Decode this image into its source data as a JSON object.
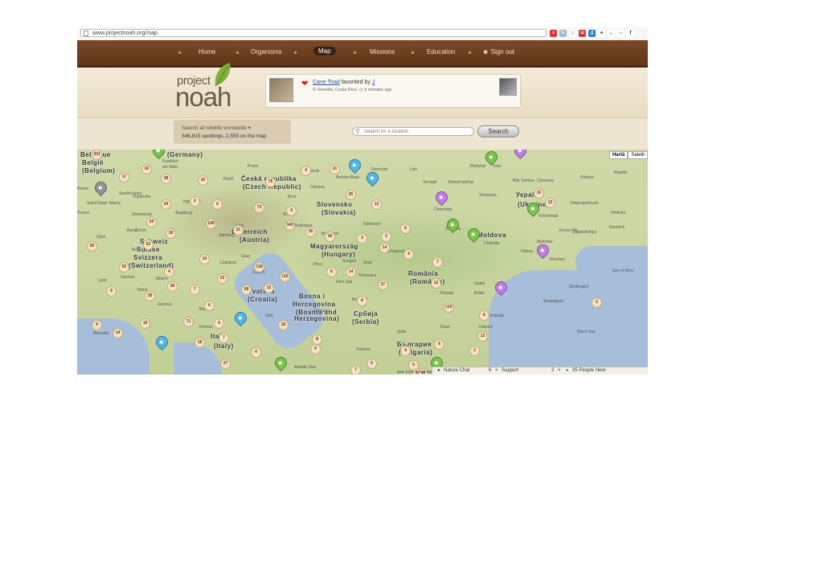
{
  "browser": {
    "url": "www.projectnoah.org/map"
  },
  "nav": {
    "items": [
      "Home",
      "Organisms",
      "Map",
      "Missions",
      "Education",
      "Sign out"
    ],
    "active": "Map"
  },
  "logo": {
    "top": "project",
    "main": "noah"
  },
  "feed": {
    "subject": "Cane Toad",
    "action": "favorited by",
    "user": "J",
    "location": "Heredia, Costa Rica",
    "time": "9 minutes ago"
  },
  "stats": {
    "title": "Search all wildlife worldwide ▾",
    "count": "346,815 spottings, 2,555 on the map"
  },
  "search": {
    "placeholder": "Search for a location",
    "button": "Search"
  },
  "map": {
    "type_buttons": [
      "Hartă",
      "Satelit"
    ],
    "countries": [
      [
        "(Germany)",
        112,
        2
      ],
      [
        "Belgique",
        4,
        2
      ],
      [
        "België",
        6,
        12
      ],
      [
        "(Belgium)",
        6,
        22
      ],
      [
        "Česká republika",
        204,
        32
      ],
      [
        "(Czech Republic)",
        206,
        42
      ],
      [
        "Slovensko",
        298,
        64
      ],
      [
        "(Slovakia)",
        304,
        74
      ],
      [
        "Österreich",
        192,
        98
      ],
      [
        "(Austria)",
        202,
        108
      ],
      [
        "Magyarország",
        290,
        116
      ],
      [
        "(Hungary)",
        304,
        126
      ],
      [
        "Schweiz",
        78,
        110
      ],
      [
        "Suisse",
        74,
        120
      ],
      [
        "Svizzera",
        70,
        130
      ],
      [
        "(Switzerland)",
        64,
        140
      ],
      [
        "România",
        412,
        150
      ],
      [
        "(România)",
        414,
        160
      ],
      [
        "Україна",
        546,
        52
      ],
      [
        "(Ukraine)",
        548,
        64
      ],
      [
        "Moldova",
        498,
        102
      ],
      [
        "Hrvatska",
        208,
        172
      ],
      [
        "(Croatia)",
        212,
        182
      ],
      [
        "Bosna i",
        276,
        178
      ],
      [
        "Hercegovina",
        268,
        188
      ],
      [
        "(Bosnia and",
        272,
        198
      ],
      [
        "Herzegovina)",
        270,
        206
      ],
      [
        "Србија",
        344,
        200
      ],
      [
        "(Serbia)",
        342,
        210
      ],
      [
        "Italia",
        166,
        228
      ],
      [
        "(Italy)",
        170,
        240
      ],
      [
        "България",
        398,
        238
      ],
      [
        "(Bulgaria)",
        400,
        248
      ]
    ],
    "cities": [
      [
        "Frankfurt",
        106,
        12
      ],
      [
        "am Main",
        106,
        19
      ],
      [
        "Praha",
        212,
        18
      ],
      [
        "Rybnik",
        286,
        24
      ],
      [
        "Bielsko-Biała",
        322,
        32
      ],
      [
        "Rzeszów",
        366,
        22
      ],
      [
        "Lviv",
        414,
        22
      ],
      [
        "Ternopil",
        430,
        38
      ],
      [
        "Khmel'nyts'kyi",
        462,
        38
      ],
      [
        "Zhytomyr",
        488,
        18
      ],
      [
        "Kiev",
        518,
        18
      ],
      [
        "Poltava",
        626,
        32
      ],
      [
        "Cherkasy",
        572,
        36
      ],
      [
        "Bila Tserkva",
        542,
        36
      ],
      [
        "Vinnytsya",
        500,
        54
      ],
      [
        "Kirovohrad",
        574,
        80
      ],
      [
        "Dnipropetrovs'k",
        614,
        64
      ],
      [
        "Zaporizhzhya",
        616,
        100
      ],
      [
        "Kryvyi Rih",
        600,
        98
      ],
      [
        "Mykolaiv",
        572,
        112
      ],
      [
        "Odesa",
        552,
        124
      ],
      [
        "Kherson",
        588,
        134
      ],
      [
        "Chişinău",
        506,
        114
      ],
      [
        "Chernivtsi",
        444,
        72
      ],
      [
        "Suceava",
        458,
        96
      ],
      [
        "Galati",
        494,
        164
      ],
      [
        "Brăila",
        494,
        176
      ],
      [
        "Ploieşti",
        452,
        176
      ],
      [
        "Constanţa",
        508,
        204
      ],
      [
        "Dobrich",
        500,
        218
      ],
      [
        "Varna",
        498,
        232
      ],
      [
        "Ruse",
        452,
        218
      ],
      [
        "Sofia",
        398,
        224
      ],
      [
        "Kosovo",
        348,
        246
      ],
      [
        "Wien",
        256,
        78
      ],
      [
        "Bratislava",
        270,
        92
      ],
      [
        "Budapest",
        304,
        102
      ],
      [
        "Debrecen",
        356,
        90
      ],
      [
        "Szeged",
        330,
        136
      ],
      [
        "Timişoara",
        350,
        154
      ],
      [
        "Arad",
        356,
        138
      ],
      [
        "Cluj-Napoca",
        380,
        124
      ],
      [
        "Novi Sad",
        322,
        162
      ],
      [
        "Beograd",
        342,
        184
      ],
      [
        "Zürich",
        72,
        98
      ],
      [
        "Basel",
        62,
        98
      ],
      [
        "Bern",
        68,
        122
      ],
      [
        "Genève",
        54,
        156
      ],
      [
        "Lyon",
        26,
        160
      ],
      [
        "Marseille",
        20,
        226
      ],
      [
        "Milano",
        98,
        158
      ],
      [
        "Torino",
        74,
        172
      ],
      [
        "Genova",
        100,
        190
      ],
      [
        "Bologna",
        152,
        196
      ],
      [
        "Firenze",
        152,
        218
      ],
      [
        "Ljubljana",
        178,
        138
      ],
      [
        "Zagreb",
        218,
        150
      ],
      [
        "Graz",
        204,
        130
      ],
      [
        "Linz",
        198,
        92
      ],
      [
        "Salzburg",
        176,
        104
      ],
      [
        "Nancy",
        40,
        64
      ],
      [
        "Saarbrücken",
        52,
        52
      ],
      [
        "Strasbourg",
        68,
        78
      ],
      [
        "Karlsruhe",
        70,
        56
      ],
      [
        "Augsburg",
        122,
        76
      ],
      [
        "Ingolstadt",
        132,
        62
      ],
      [
        "Plzeň",
        182,
        34
      ],
      [
        "Brno",
        262,
        56
      ],
      [
        "Ostrava",
        290,
        44
      ],
      [
        "Pécs",
        294,
        140
      ],
      [
        "Split",
        234,
        204
      ],
      [
        "Sarajevo",
        294,
        198
      ],
      [
        "Simferopol",
        612,
        168
      ],
      [
        "Sevastopol",
        580,
        186
      ],
      [
        "Black Sea",
        622,
        224
      ],
      [
        "Sea of Azov",
        666,
        148
      ],
      [
        "Adriatic Sea",
        270,
        268
      ],
      [
        "Reims",
        0,
        46
      ],
      [
        "Troyes",
        0,
        76
      ],
      [
        "Dijon",
        24,
        106
      ],
      [
        "Saint-Dizier",
        12,
        64
      ],
      [
        "Kharkiv",
        668,
        26
      ],
      [
        "Horlivka",
        664,
        76
      ],
      [
        "Donets'k",
        662,
        94
      ]
    ],
    "clusters": [
      [
        "201",
        18,
        0
      ],
      [
        "33",
        80,
        18
      ],
      [
        "38",
        104,
        30
      ],
      [
        "17",
        52,
        28
      ],
      [
        "16",
        150,
        32
      ],
      [
        "76",
        234,
        34
      ],
      [
        "4",
        278,
        20
      ],
      [
        "21",
        314,
        18
      ],
      [
        "25",
        334,
        50
      ],
      [
        "12",
        366,
        62
      ],
      [
        "6",
        402,
        92
      ],
      [
        "15",
        568,
        48
      ],
      [
        "13",
        582,
        60
      ],
      [
        "2",
        140,
        58
      ],
      [
        "24",
        104,
        62
      ],
      [
        "6",
        168,
        62
      ],
      [
        "73",
        220,
        66
      ],
      [
        "4",
        260,
        70
      ],
      [
        "20",
        86,
        84
      ],
      [
        "106",
        160,
        86
      ],
      [
        "21",
        194,
        94
      ],
      [
        "345",
        258,
        88
      ],
      [
        "35",
        284,
        96
      ],
      [
        "36",
        308,
        102
      ],
      [
        "3",
        348,
        104
      ],
      [
        "3",
        378,
        102
      ],
      [
        "14",
        376,
        116
      ],
      [
        "4",
        406,
        124
      ],
      [
        "28",
        110,
        98
      ],
      [
        "53",
        82,
        112
      ],
      [
        "20",
        12,
        114
      ],
      [
        "14",
        152,
        130
      ],
      [
        "7",
        442,
        134
      ],
      [
        "118",
        220,
        140
      ],
      [
        "116",
        252,
        152
      ],
      [
        "6",
        310,
        146
      ],
      [
        "14",
        334,
        146
      ],
      [
        "92",
        52,
        140
      ],
      [
        "4",
        108,
        146
      ],
      [
        "23",
        174,
        154
      ],
      [
        "36",
        112,
        164
      ],
      [
        "7",
        140,
        168
      ],
      [
        "68",
        204,
        168
      ],
      [
        "12",
        232,
        166
      ],
      [
        "27",
        374,
        162
      ],
      [
        "12",
        440,
        160
      ],
      [
        "9",
        36,
        170
      ],
      [
        "28",
        84,
        176
      ],
      [
        "6",
        158,
        188
      ],
      [
        "8",
        348,
        182
      ],
      [
        "116",
        456,
        190
      ],
      [
        "6",
        500,
        200
      ],
      [
        "71",
        132,
        208
      ],
      [
        "4",
        170,
        210
      ],
      [
        "18",
        78,
        210
      ],
      [
        "9",
        18,
        212
      ],
      [
        "14",
        44,
        222
      ],
      [
        "16",
        250,
        212
      ],
      [
        "13",
        498,
        226
      ],
      [
        "2",
        640,
        184
      ],
      [
        "18",
        146,
        234
      ],
      [
        "7",
        176,
        228
      ],
      [
        "4",
        216,
        246
      ],
      [
        "8",
        292,
        230
      ],
      [
        "9",
        290,
        242
      ],
      [
        "4",
        402,
        244
      ],
      [
        "6",
        444,
        236
      ],
      [
        "2",
        488,
        244
      ],
      [
        "27",
        178,
        260
      ],
      [
        "5",
        360,
        260
      ],
      [
        "6",
        412,
        262
      ],
      [
        "5",
        416,
        272
      ],
      [
        "7",
        340,
        268
      ],
      [
        "12",
        502,
        268
      ],
      [
        "10",
        424,
        272
      ]
    ],
    "pins": [
      [
        "green",
        94,
        -6
      ],
      [
        "green",
        508,
        2
      ],
      [
        "purple",
        544,
        -6
      ],
      [
        "gray",
        22,
        40
      ],
      [
        "blue",
        338,
        12
      ],
      [
        "blue",
        360,
        28
      ],
      [
        "purple",
        446,
        52
      ],
      [
        "green",
        460,
        86
      ],
      [
        "green",
        486,
        98
      ],
      [
        "green",
        560,
        66
      ],
      [
        "purple",
        572,
        118
      ],
      [
        "purple",
        520,
        164
      ],
      [
        "blue",
        196,
        202
      ],
      [
        "blue",
        98,
        232
      ],
      [
        "green",
        246,
        258
      ],
      [
        "green",
        440,
        258
      ]
    ]
  },
  "chat": {
    "nature_chat": "Nature Chat",
    "nature_count": "6",
    "support": "Support",
    "support_count": "2",
    "people": "35 People Here"
  },
  "copyright": "Date hartă ©2012 Basarsoft, Google"
}
